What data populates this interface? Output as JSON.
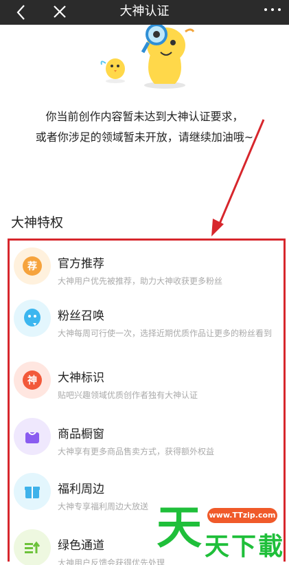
{
  "header": {
    "title": "大神认证",
    "back_icon": "back-arrow-icon",
    "close_icon": "close-icon",
    "more_icon": "more-dots-icon"
  },
  "message": {
    "line1": "你当前创作内容暂未达到大神认证要求，",
    "line2": "或者你涉足的领域暂未开放，请继续加油哦~"
  },
  "section": {
    "title": "大神特权"
  },
  "privileges": [
    {
      "name": "官方推荐",
      "desc": "大神用户优先被推荐，助力大神收获更多粉丝",
      "icon_glyph": "荐",
      "icon": "recommend-icon",
      "bg": "#fff1dd",
      "color": "#f6a33c"
    },
    {
      "name": "粉丝召唤",
      "desc": "大神每周可行使一次，选择近期优质作品让更多的粉丝看到",
      "icon_glyph": "",
      "icon": "fans-summon-icon",
      "bg": "#e3f6fd",
      "color": "#3cb6ef"
    },
    {
      "name": "大神标识",
      "desc": "贴吧兴趣领域优质创作者独有大神认证",
      "icon_glyph": "神",
      "icon": "badge-icon",
      "bg": "#ffe6e0",
      "color": "#f2593a"
    },
    {
      "name": "商品橱窗",
      "desc": "大神享有更多商品售卖方式，获得额外权益",
      "icon_glyph": "",
      "icon": "shop-bag-icon",
      "bg": "#efe8fd",
      "color": "#8a5cf0"
    },
    {
      "name": "福利周边",
      "desc": "大神专享福利周边大放送",
      "icon_glyph": "",
      "icon": "gift-icon",
      "bg": "#e3f6fd",
      "color": "#3fb2ea"
    },
    {
      "name": "绿色通道",
      "desc": "大神用户反馈会获得优先处理",
      "icon_glyph": "",
      "icon": "green-channel-icon",
      "bg": "#eef8e0",
      "color": "#6cc23a"
    }
  ],
  "watermark": {
    "site": "www.TTzip.com",
    "big": "天",
    "small": "天下載"
  },
  "colors": {
    "annotation": "#d7262c",
    "header_bg": "#2b2b2b"
  }
}
